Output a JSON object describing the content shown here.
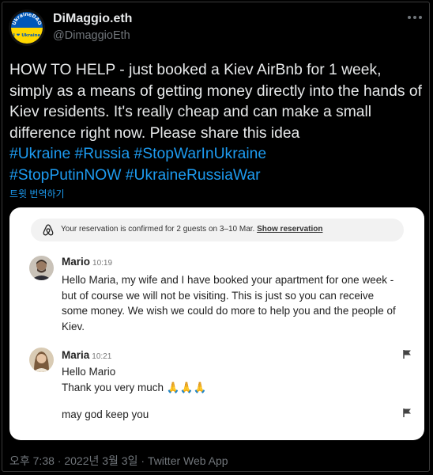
{
  "user": {
    "display_name": "DiMaggio.eth",
    "handle": "@DimaggioEth",
    "avatar_text_top": "UkraineDAO",
    "avatar_text_bottom": "I ❤ Ukraine"
  },
  "tweet": {
    "text": "HOW TO HELP - just booked a Kiev AirBnb for 1 week, simply as a means of getting money directly into the hands of Kiev residents. It's really cheap and can make a small difference right now. Please share this idea",
    "hashtags_line1": "#Ukraine #Russia #StopWarInUkraine",
    "hashtags_line2": "#StopPutinNOW #UkraineRussiaWar",
    "translate_label": "트윗 번역하기",
    "timestamp": "오후 7:38 · 2022년 3월 3일 · Twitter Web App"
  },
  "card": {
    "banner_text": "Your reservation is confirmed for 2 guests on 3–10 Mar.",
    "banner_link": "Show reservation",
    "messages": [
      {
        "sender": "Mario",
        "time": "10:19",
        "lines": [
          "Hello Maria, my wife and I have booked your apartment for one week -",
          "but of course we will not be visiting. This is just so you can receive",
          "some money. We wish we could do more to help you and the people of",
          "Kiev."
        ]
      },
      {
        "sender": "Maria",
        "time": "10:21",
        "lines": [
          "Hello Mario",
          "Thank you very much"
        ],
        "emoji": "🙏🙏🙏",
        "followup": "may god keep you"
      }
    ]
  },
  "colors": {
    "background": "#000000",
    "text": "#e7e9ea",
    "muted": "#71767b",
    "link": "#1d9bf0",
    "ukraine_blue": "#0057b8",
    "ukraine_yellow": "#ffd700",
    "airbnb": "#222222"
  }
}
